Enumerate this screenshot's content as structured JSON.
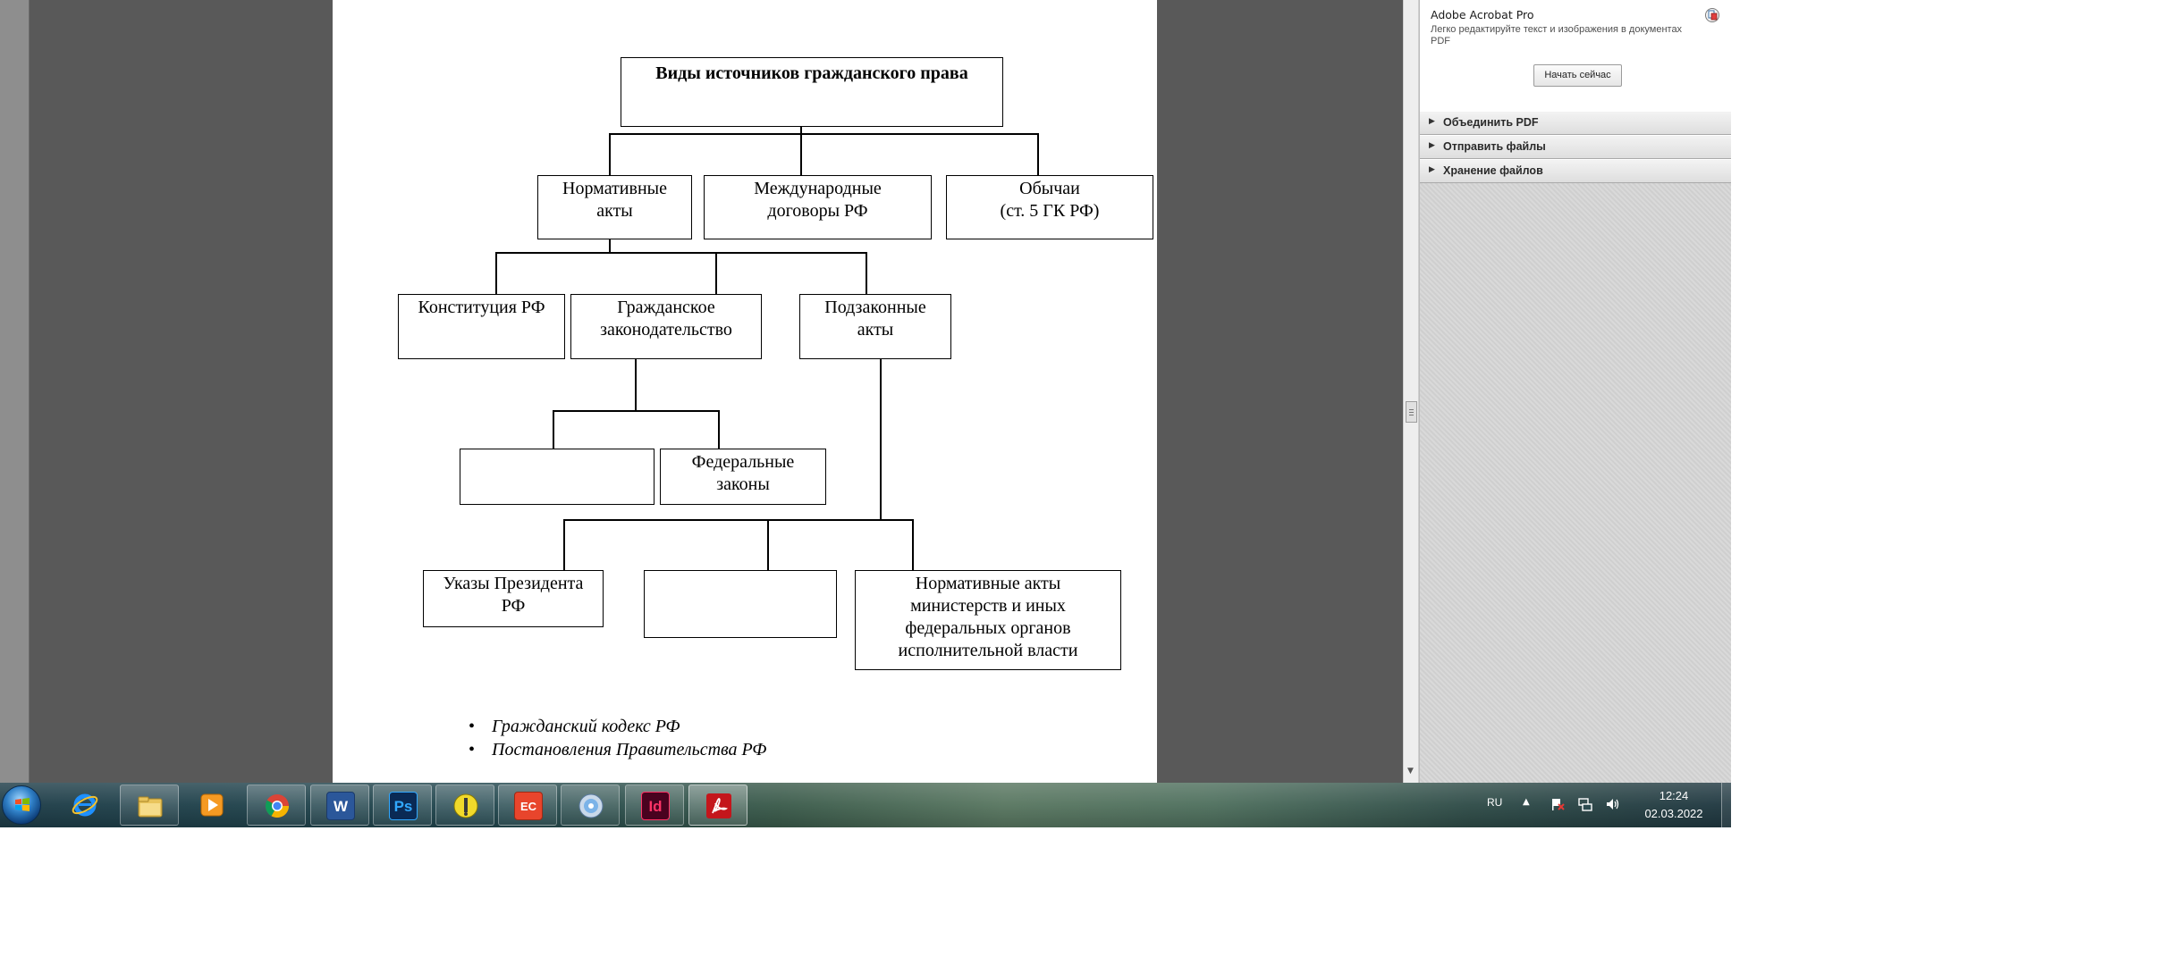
{
  "document": {
    "chart": {
      "title": "Виды источников гражданского права",
      "level1": [
        "Нормативные\nакты",
        "Международные\nдоговоры РФ",
        "Обычаи\n(ст. 5 ГК РФ)"
      ],
      "level2": [
        "Конституция РФ",
        "Гражданское\nзаконодательство",
        "Подзаконные\nакты"
      ],
      "level3": [
        "",
        "Федеральные\nзаконы"
      ],
      "level4": [
        "Указы Президента\nРФ",
        "",
        "Нормативные акты\nминистерств и иных\nфедеральных органов\nисполнительной власти"
      ]
    },
    "list": [
      "Гражданский кодекс РФ",
      "Постановления Правительства РФ"
    ]
  },
  "tools_panel": {
    "promo_title": "Adobe Acrobat Pro",
    "promo_desc": "Легко редактируйте текст и изображения в документах PDF",
    "start_button": "Начать сейчас",
    "sections": [
      "Объединить PDF",
      "Отправить файлы",
      "Хранение файлов"
    ]
  },
  "taskbar": {
    "apps": [
      {
        "name": "ie",
        "icon": "internet-explorer-icon"
      },
      {
        "name": "explorer",
        "icon": "folder-icon"
      },
      {
        "name": "media-player",
        "icon": "media-player-icon"
      },
      {
        "name": "chrome",
        "icon": "chrome-icon"
      },
      {
        "name": "word",
        "icon": "word-icon",
        "label": "W"
      },
      {
        "name": "photoshop",
        "icon": "photoshop-icon",
        "label": "Ps"
      },
      {
        "name": "app-yellow",
        "icon": "yellow-app-icon"
      },
      {
        "name": "app-ec",
        "icon": "ec-app-icon",
        "label": "EC"
      },
      {
        "name": "dvd",
        "icon": "dvd-icon"
      },
      {
        "name": "indesign",
        "icon": "indesign-icon",
        "label": "Id"
      },
      {
        "name": "acrobat",
        "icon": "acrobat-icon"
      }
    ],
    "tray": {
      "lang": "RU",
      "time": "12:24",
      "date": "02.03.2022"
    }
  },
  "colors": {
    "doc_bg": "#595959",
    "page": "#ffffff",
    "panel_bg": "#d9d9d9"
  }
}
